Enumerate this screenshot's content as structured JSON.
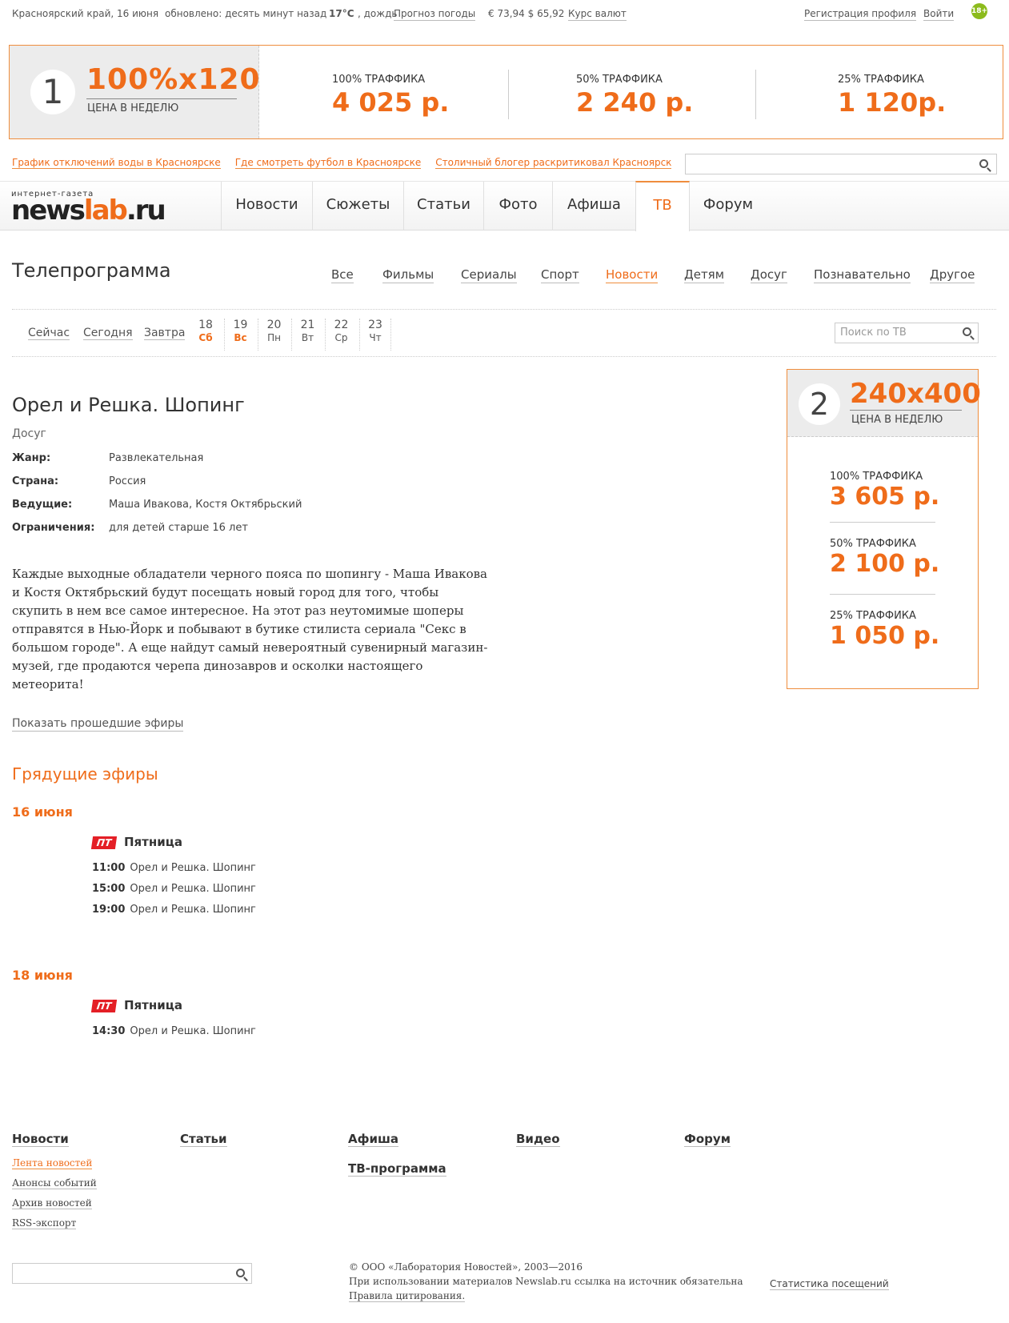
{
  "topbar": {
    "region": "Красноярский край, 16 июня",
    "updated": "обновлено: десять минут назад",
    "temp": "17°C",
    "weather": ", дождь",
    "forecast": "Прогноз погоды",
    "rates": "€ 73,94 $ 65,92",
    "rates_link": "Курс валют",
    "register": "Регистрация профиля",
    "login": "Войти",
    "age": "18+"
  },
  "banner1": {
    "num": "1",
    "size": "100%x120",
    "price_label": "ЦЕНА В НЕДЕЛЮ",
    "t1_label": "100% ТРАФФИКА",
    "t1_price": "4 025 р.",
    "t2_label": "50% ТРАФФИКА",
    "t2_price": "2 240 р.",
    "t3_label": "25% ТРАФФИКА",
    "t3_price": "1 120р."
  },
  "quicklinks": [
    "График отключений воды в Красноярске",
    "Где смотреть футбол в Красноярске",
    "Столичный блогер раскритиковал Красноярск"
  ],
  "logo": {
    "sub": "интернет-газета",
    "news": "news",
    "lab": "lab",
    "ru": ".ru"
  },
  "nav": [
    "Новости",
    "Сюжеты",
    "Статьи",
    "Фото",
    "Афиша",
    "ТВ",
    "Форум"
  ],
  "tv": {
    "title": "Телепрограмма",
    "categories": [
      "Все",
      "Фильмы",
      "Сериалы",
      "Спорт",
      "Новости",
      "Детям",
      "Досуг",
      "Познавательно",
      "Другое"
    ],
    "days": [
      "Сейчас",
      "Сегодня",
      "Завтра"
    ],
    "dates": [
      {
        "d": "18",
        "w": "Сб"
      },
      {
        "d": "19",
        "w": "Вс"
      },
      {
        "d": "20",
        "w": "Пн"
      },
      {
        "d": "21",
        "w": "Вт"
      },
      {
        "d": "22",
        "w": "Ср"
      },
      {
        "d": "23",
        "w": "Чт"
      }
    ],
    "search_placeholder": "Поиск по ТВ"
  },
  "program": {
    "title": "Орел и Решка. Шопинг",
    "category": "Досуг",
    "genre_label": "Жанр:",
    "genre": "Развлекательная",
    "country_label": "Страна:",
    "country": "Россия",
    "hosts_label": "Ведущие:",
    "hosts": "Маша Ивакова, Костя Октябрьский",
    "limits_label": "Ограничения:",
    "limits": "для детей старше 16 лет",
    "description": "Каждые выходные обладатели черного пояса по шопингу - Маша Ивакова и Костя Октябрьский будут посещать новый город для того, чтобы скупить в нем все самое интересное. На этот раз неутомимые шоперы отправятся в Нью-Йорк и побывают в бутике стилиста сериала \"Секс в большом городе\". А еще найдут самый невероятный сувенирный магазин-музей, где продаются черепа динозавров и осколки настоящего метеорита!",
    "show_past": "Показать прошедшие эфиры",
    "upcoming": "Грядущие эфиры"
  },
  "schedule": {
    "day1": "16 июня",
    "day2": "18 июня",
    "channel_logo": "ПТ",
    "channel": "Пятница",
    "a1t": "11:00",
    "a2t": "15:00",
    "a3t": "19:00",
    "a4t": "14:30",
    "show": "Орел и Решка. Шопинг"
  },
  "banner2": {
    "num": "2",
    "size": "240x400",
    "price_label": "ЦЕНА В НЕДЕЛЮ",
    "t1_label": "100% ТРАФФИКА",
    "t1_price": "3 605 р.",
    "t2_label": "50% ТРАФФИКА",
    "t2_price": "2 100 р.",
    "t3_label": "25% ТРАФФИКА",
    "t3_price": "1 050 р."
  },
  "footer": {
    "news": "Новости",
    "articles": "Статьи",
    "afisha": "Афиша",
    "tvprog": "ТВ-программа",
    "video": "Видео",
    "forum": "Форум",
    "l1": "Лента новостей",
    "l2": "Анонсы событий",
    "l3": "Архив новостей",
    "l4": "RSS-экспорт",
    "copy1": "© ООО «Лаборатория Новостей», 2003—2016",
    "copy2": "При использовании материалов Newslab.ru ссылка на источник обязательна",
    "copy3": "Правила цитирования.",
    "stats": "Статистика посещений"
  },
  "colors": {
    "accent": "#ef6c1a",
    "age_badge": "#8cbb1c",
    "channel": "#e41f26"
  }
}
